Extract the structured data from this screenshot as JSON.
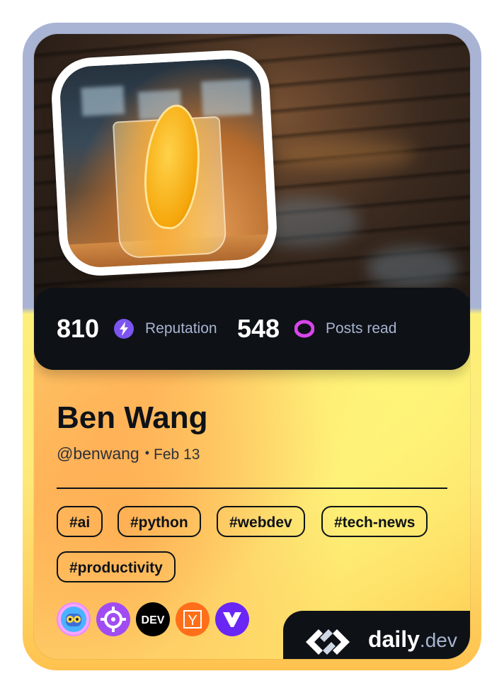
{
  "stats": {
    "reputation_value": "810",
    "reputation_label": "Reputation",
    "posts_value": "548",
    "posts_label": "Posts read"
  },
  "profile": {
    "name": "Ben Wang",
    "handle": "@benwang",
    "separator": "•",
    "date": "Feb 13"
  },
  "tags": [
    "#ai",
    "#python",
    "#webdev",
    "#tech-news",
    "#productivity"
  ],
  "sources": [
    {
      "icon": "robot-avatar-icon"
    },
    {
      "icon": "crosshair-icon"
    },
    {
      "icon": "dev-to-icon",
      "text": "DEV"
    },
    {
      "icon": "hacker-news-icon",
      "text": "Y"
    },
    {
      "icon": "vercel-v-icon"
    }
  ],
  "brand": {
    "name": "daily",
    "suffix": ".dev"
  },
  "colors": {
    "frame_top": "#a9b3d4",
    "frame_bottom": "#fde97a",
    "dark": "#0e1217",
    "reputation_accent": "#7c54f0",
    "posts_accent": "#d845ec",
    "label_gray": "#a8b3cf"
  }
}
